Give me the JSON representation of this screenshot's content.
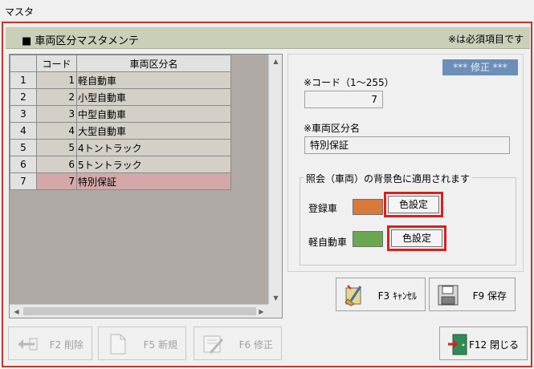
{
  "window": {
    "title": "マスタ"
  },
  "header": {
    "title": "■ 車両区分マスタメンテ",
    "required_note": "※は必須項目です"
  },
  "grid": {
    "columns": [
      "コード",
      "車両区分名"
    ],
    "rows": [
      {
        "row_no": "1",
        "code": "1",
        "name": "軽自動車"
      },
      {
        "row_no": "2",
        "code": "2",
        "name": "小型自動車"
      },
      {
        "row_no": "3",
        "code": "3",
        "name": "中型自動車"
      },
      {
        "row_no": "4",
        "code": "4",
        "name": "大型自動車"
      },
      {
        "row_no": "5",
        "code": "5",
        "name": "4トントラック"
      },
      {
        "row_no": "6",
        "code": "6",
        "name": "5トントラック"
      },
      {
        "row_no": "7",
        "code": "7",
        "name": "特別保証"
      }
    ]
  },
  "form": {
    "mode_badge": "*** 修正 ***",
    "code_label": "※コード（1～255）",
    "code_value": "7",
    "name_label": "※車両区分名",
    "name_value": "特別保証",
    "color_group_title": "照会（車両）の背景色に適用されます",
    "registered_label": "登録車",
    "registered_color": "#d97a3a",
    "kei_label": "軽自動車",
    "kei_color": "#6aa84f",
    "color_button_label": "色設定",
    "highlight_color": "#d9201f"
  },
  "buttons": {
    "cancel": "F3 ｷｬﾝｾﾙ",
    "save": "F9 保存",
    "delete": "F2 削除",
    "new": "F5 新規",
    "edit": "F6 修正",
    "close": "F12 閉じる"
  }
}
